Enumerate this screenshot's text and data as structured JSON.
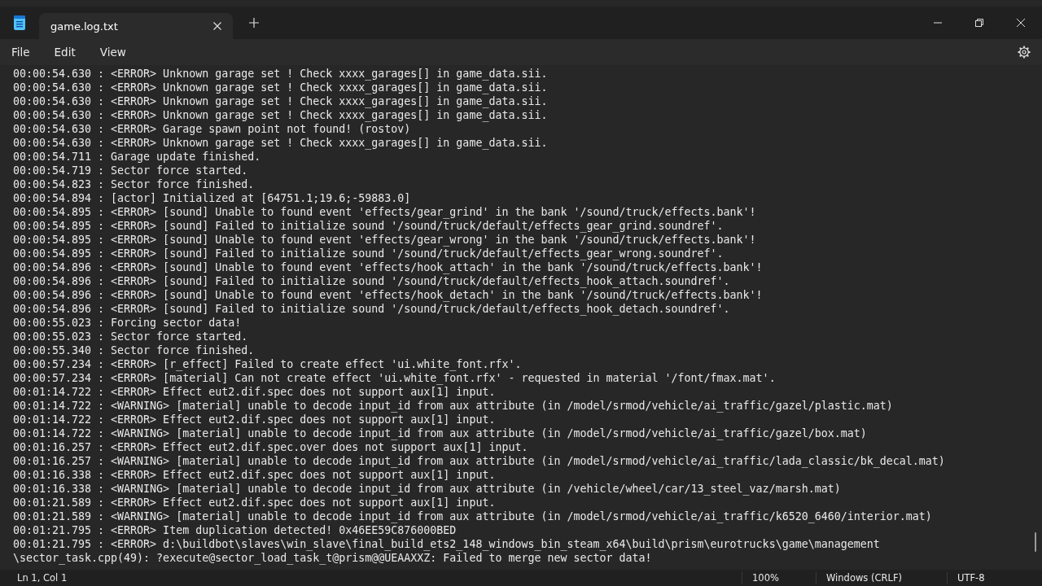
{
  "tabs": [
    {
      "title": "game.log.txt",
      "selected": true
    }
  ],
  "menu": [
    "File",
    "Edit",
    "View"
  ],
  "lines": [
    "00:00:54.630 : <ERROR> Unknown garage set ! Check xxxx_garages[] in game_data.sii.",
    "00:00:54.630 : <ERROR> Unknown garage set ! Check xxxx_garages[] in game_data.sii.",
    "00:00:54.630 : <ERROR> Unknown garage set ! Check xxxx_garages[] in game_data.sii.",
    "00:00:54.630 : <ERROR> Unknown garage set ! Check xxxx_garages[] in game_data.sii.",
    "00:00:54.630 : <ERROR> Garage spawn point not found! (rostov)",
    "00:00:54.630 : <ERROR> Unknown garage set ! Check xxxx_garages[] in game_data.sii.",
    "00:00:54.711 : Garage update finished.",
    "00:00:54.719 : Sector force started.",
    "00:00:54.823 : Sector force finished.",
    "00:00:54.894 : [actor] Initialized at [64751.1;19.6;-59883.0]",
    "00:00:54.895 : <ERROR> [sound] Unable to found event 'effects/gear_grind' in the bank '/sound/truck/effects.bank'!",
    "00:00:54.895 : <ERROR> [sound] Failed to initialize sound '/sound/truck/default/effects_gear_grind.soundref'.",
    "00:00:54.895 : <ERROR> [sound] Unable to found event 'effects/gear_wrong' in the bank '/sound/truck/effects.bank'!",
    "00:00:54.895 : <ERROR> [sound] Failed to initialize sound '/sound/truck/default/effects_gear_wrong.soundref'.",
    "00:00:54.896 : <ERROR> [sound] Unable to found event 'effects/hook_attach' in the bank '/sound/truck/effects.bank'!",
    "00:00:54.896 : <ERROR> [sound] Failed to initialize sound '/sound/truck/default/effects_hook_attach.soundref'.",
    "00:00:54.896 : <ERROR> [sound] Unable to found event 'effects/hook_detach' in the bank '/sound/truck/effects.bank'!",
    "00:00:54.896 : <ERROR> [sound] Failed to initialize sound '/sound/truck/default/effects_hook_detach.soundref'.",
    "00:00:55.023 : Forcing sector data!",
    "00:00:55.023 : Sector force started.",
    "00:00:55.340 : Sector force finished.",
    "00:00:57.234 : <ERROR> [r_effect] Failed to create effect 'ui.white_font.rfx'.",
    "00:00:57.234 : <ERROR> [material] Can not create effect 'ui.white_font.rfx' - requested in material '/font/fmax.mat'.",
    "00:01:14.722 : <ERROR> Effect eut2.dif.spec does not support aux[1] input.",
    "00:01:14.722 : <WARNING> [material] unable to decode input_id from aux attribute (in /model/srmod/vehicle/ai_traffic/gazel/plastic.mat)",
    "00:01:14.722 : <ERROR> Effect eut2.dif.spec does not support aux[1] input.",
    "00:01:14.722 : <WARNING> [material] unable to decode input_id from aux attribute (in /model/srmod/vehicle/ai_traffic/gazel/box.mat)",
    "00:01:16.257 : <ERROR> Effect eut2.dif.spec.over does not support aux[1] input.",
    "00:01:16.257 : <WARNING> [material] unable to decode input_id from aux attribute (in /model/srmod/vehicle/ai_traffic/lada_classic/bk_decal.mat)",
    "00:01:16.338 : <ERROR> Effect eut2.dif.spec does not support aux[1] input.",
    "00:01:16.338 : <WARNING> [material] unable to decode input_id from aux attribute (in /vehicle/wheel/car/13_steel_vaz/marsh.mat)",
    "00:01:21.589 : <ERROR> Effect eut2.dif.spec does not support aux[1] input.",
    "00:01:21.589 : <WARNING> [material] unable to decode input_id from aux attribute (in /model/srmod/vehicle/ai_traffic/k6520_6460/interior.mat)",
    "00:01:21.795 : <ERROR> Item duplication detected! 0x46EE59C876000BED",
    "00:01:21.795 : <ERROR> d:\\buildbot\\slaves\\win_slave\\final_build_ets2_148_windows_bin_steam_x64\\build\\prism\\eurotrucks\\game\\management",
    "\\sector_task.cpp(49): ?execute@sector_load_task_t@prism@@UEAAXXZ: Failed to merge new sector data!"
  ],
  "status_bar": {
    "position": "Ln 1, Col 1",
    "zoom": "100%",
    "line_endings": "Windows (CRLF)",
    "encoding": "UTF-8"
  }
}
